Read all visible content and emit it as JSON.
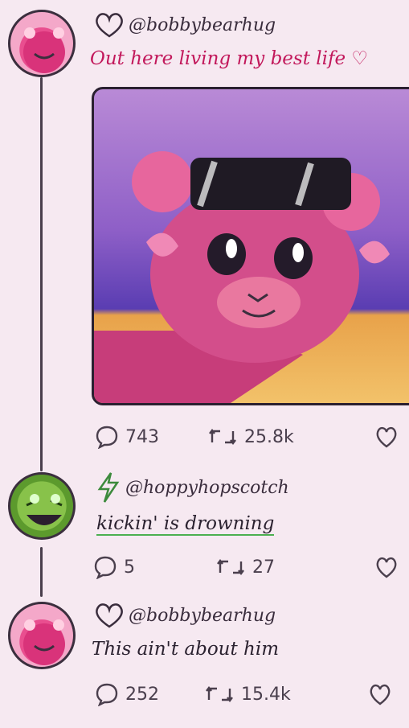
{
  "posts": [
    {
      "handle": "@bobbybearhug",
      "text": "Out here living my best life ♡",
      "stats": {
        "comments": "743",
        "reposts": "25.8k"
      }
    },
    {
      "handle": "@hoppyhopscotch",
      "text": "kickin' is drowning",
      "stats": {
        "comments": "5",
        "reposts": "27"
      }
    },
    {
      "handle": "@bobbybearhug",
      "text": "This ain't about him",
      "stats": {
        "comments": "252",
        "reposts": "15.4k"
      }
    }
  ],
  "colors": {
    "background": "#f6e9f1",
    "pink_text": "#c2185b",
    "green_underline": "#4caf50",
    "thread_line": "#4a3f4d"
  },
  "icons": [
    "heart-icon",
    "lightning-icon",
    "comment-icon",
    "repost-icon",
    "like-icon"
  ]
}
